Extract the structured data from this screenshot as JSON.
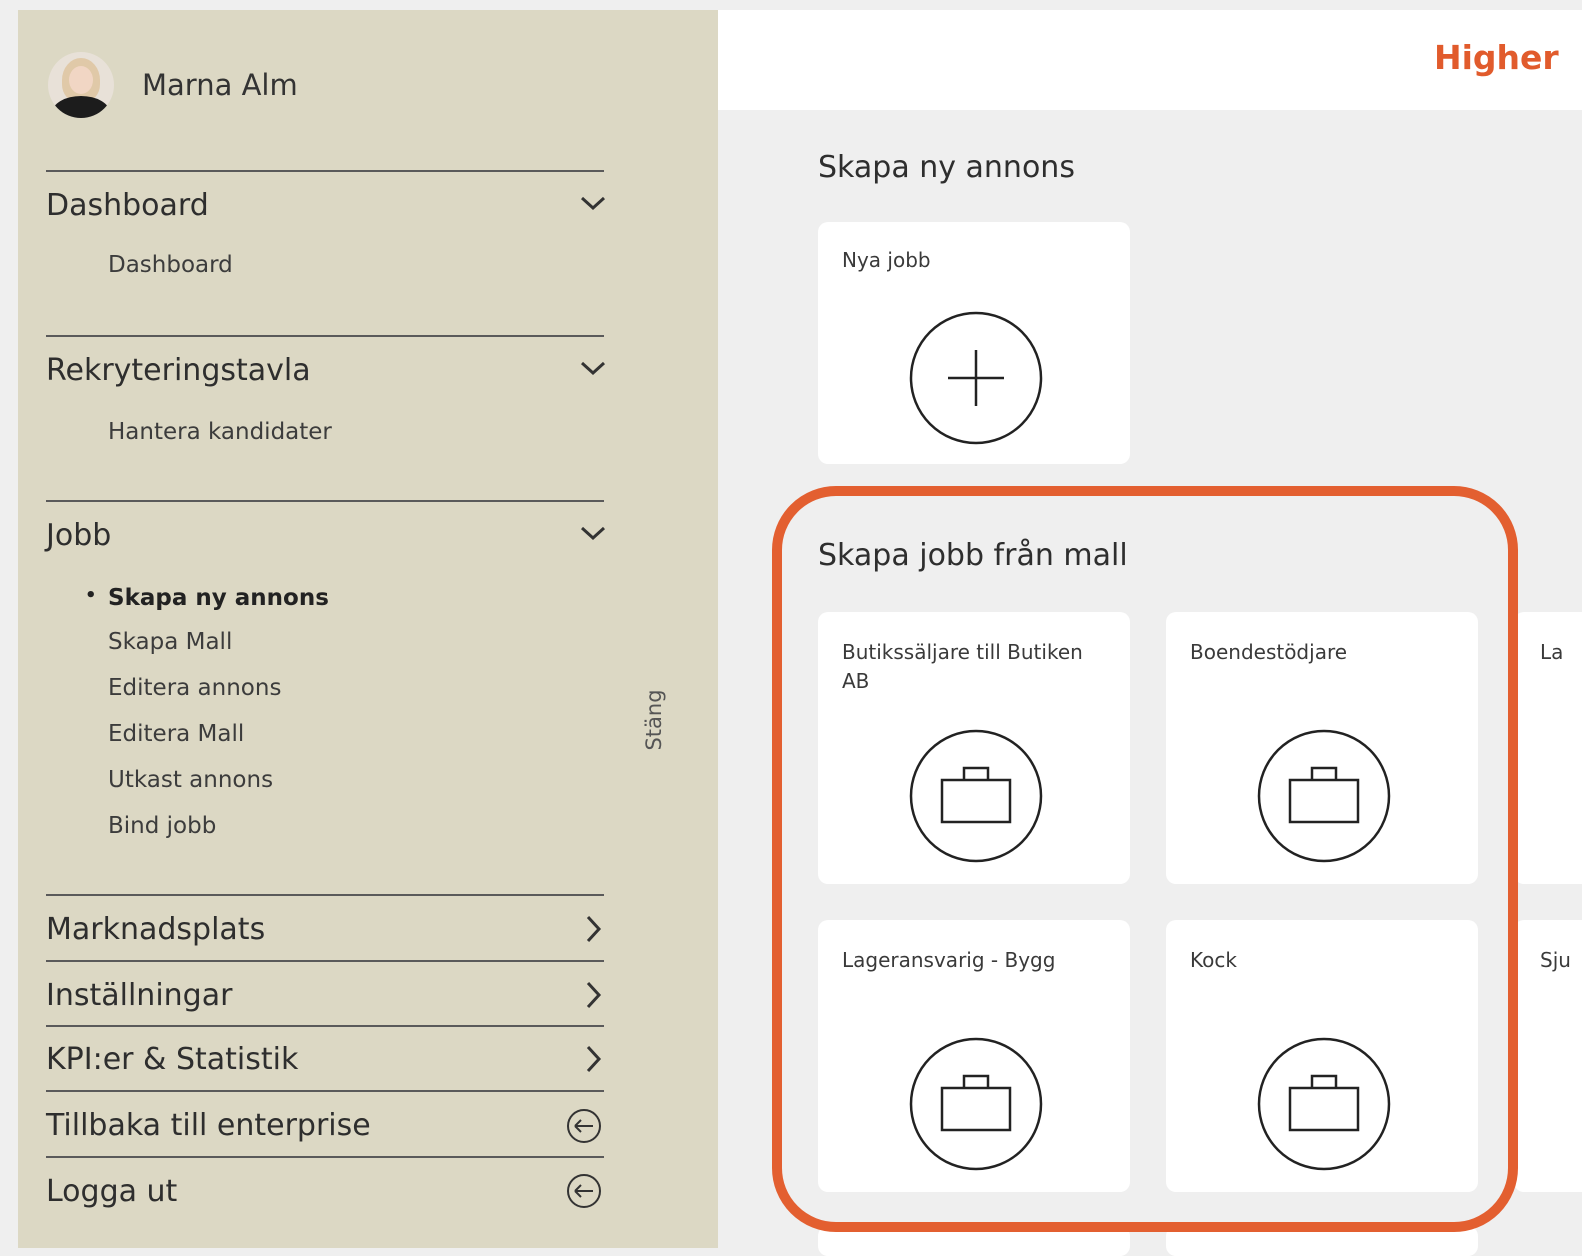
{
  "sidebar": {
    "user": {
      "name": "Marna Alm"
    },
    "sections": {
      "dashboard": {
        "title": "Dashboard",
        "items": [
          "Dashboard"
        ]
      },
      "rekrytering": {
        "title": "Rekryteringstavla",
        "items": [
          "Hantera kandidater"
        ]
      },
      "jobb": {
        "title": "Jobb",
        "items": [
          "Skapa ny annons",
          "Skapa Mall",
          "Editera annons",
          "Editera Mall",
          "Utkast annons",
          "Bind jobb"
        ],
        "active_bullet": "•"
      }
    },
    "links": {
      "marknadsplats": "Marknadsplats",
      "installningar": "Inställningar",
      "kpi": "KPI:er & Statistik",
      "tillbaka": "Tillbaka till enterprise",
      "logga_ut": "Logga ut"
    },
    "close_label": "Stäng"
  },
  "header": {
    "brand": "Higher"
  },
  "main": {
    "new_ad": {
      "title": "Skapa ny annons",
      "card_label": "Nya jobb"
    },
    "templates": {
      "title": "Skapa jobb från mall",
      "cards": [
        "Butikssäljare till Butiken AB",
        "Boendestödjare",
        "La",
        "Lageransvarig - Bygg",
        "Kock",
        "Sju"
      ]
    }
  },
  "colors": {
    "accent": "#e35f30",
    "sidebar_bg": "#dcd8c4",
    "brand": "#e15b2c"
  },
  "icons": {
    "add": "plus-circle-icon",
    "template": "briefcase-circle-icon",
    "expand": "chevron-down-icon",
    "navigate": "chevron-right-icon",
    "back": "arrow-left-circle-icon"
  }
}
